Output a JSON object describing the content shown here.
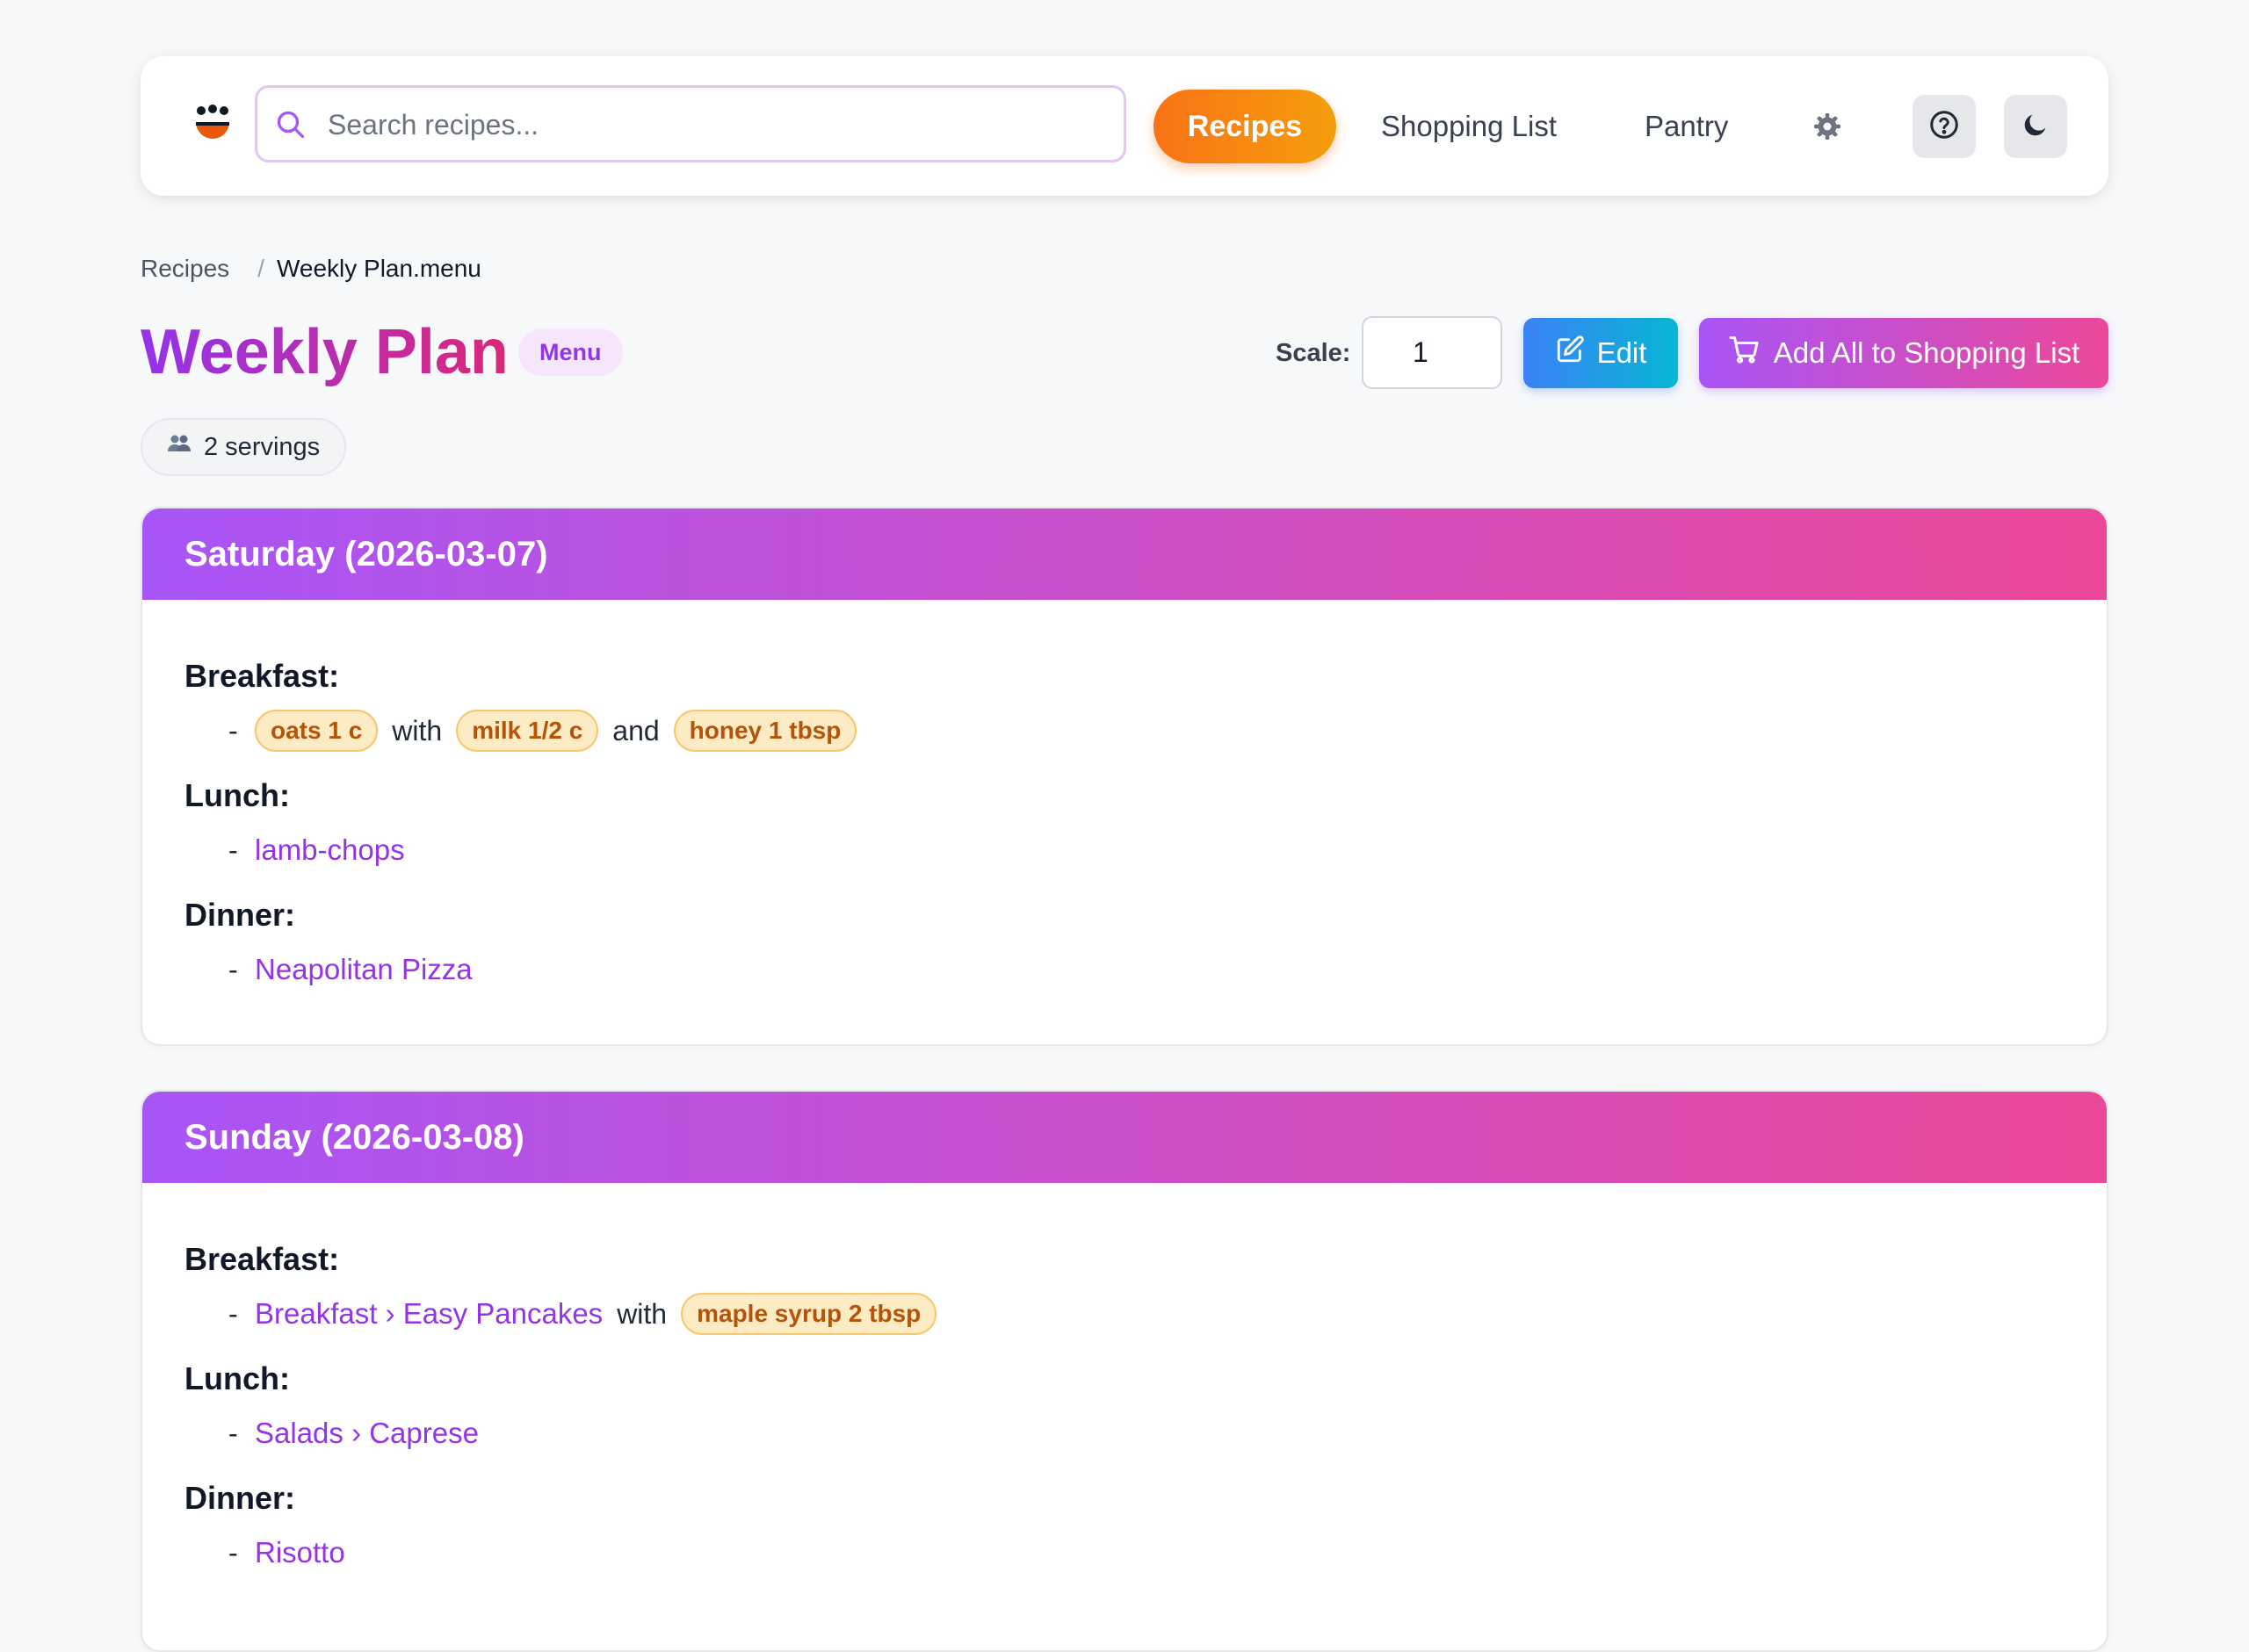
{
  "nav": {
    "search_placeholder": "Search recipes...",
    "recipes": "Recipes",
    "shopping_list": "Shopping List",
    "pantry": "Pantry"
  },
  "breadcrumb": {
    "root": "Recipes",
    "separator": "/",
    "current": "Weekly Plan.menu"
  },
  "page": {
    "title": "Weekly Plan",
    "badge": "Menu",
    "scale_label": "Scale:",
    "scale_value": "1",
    "edit_label": "Edit",
    "add_all_label": "Add All to Shopping List",
    "servings": "2 servings"
  },
  "days": [
    {
      "heading": "Saturday (2026-03-07)",
      "breakfast_label": "Breakfast:",
      "breakfast": {
        "dash": "-",
        "ing1": "oats 1 c",
        "w1": "with",
        "ing2": "milk 1/2 c",
        "w2": "and",
        "ing3": "honey 1 tbsp"
      },
      "lunch_label": "Lunch:",
      "lunch": {
        "dash": "-",
        "recipe": "lamb-chops"
      },
      "dinner_label": "Dinner:",
      "dinner": {
        "dash": "-",
        "recipe": "Neapolitan Pizza"
      }
    },
    {
      "heading": "Sunday (2026-03-08)",
      "breakfast_label": "Breakfast:",
      "breakfast": {
        "dash": "-",
        "recipe": "Breakfast › Easy Pancakes",
        "w1": "with",
        "ing1": "maple syrup 2 tbsp"
      },
      "lunch_label": "Lunch:",
      "lunch": {
        "dash": "-",
        "recipe": "Salads › Caprese"
      },
      "dinner_label": "Dinner:",
      "dinner": {
        "dash": "-",
        "recipe": "Risotto"
      }
    }
  ],
  "colors": {
    "accent_purple": "#9333ea",
    "accent_pink": "#ec4899",
    "accent_orange": "#f97316",
    "ingredient_bg": "#fdebc4",
    "ingredient_text": "#b45309"
  }
}
